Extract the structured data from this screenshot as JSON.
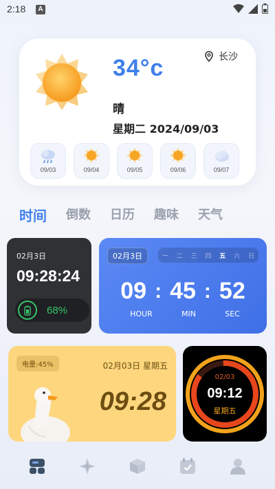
{
  "status_bar": {
    "time": "2:18",
    "indicator": "A"
  },
  "weather": {
    "temperature": "34°c",
    "location": "长沙",
    "condition": "晴",
    "date_line": "星期二 2024/09/03",
    "forecast": [
      {
        "date": "09/03",
        "icon": "rain-cloud-icon"
      },
      {
        "date": "09/04",
        "icon": "sun-icon"
      },
      {
        "date": "09/05",
        "icon": "sun-icon"
      },
      {
        "date": "09/06",
        "icon": "sun-icon"
      },
      {
        "date": "09/07",
        "icon": "cloud-icon"
      }
    ]
  },
  "tabs": [
    {
      "label": "时间",
      "active": true
    },
    {
      "label": "倒数",
      "active": false
    },
    {
      "label": "日历",
      "active": false
    },
    {
      "label": "趣味",
      "active": false
    },
    {
      "label": "天气",
      "active": false
    }
  ],
  "widgets": {
    "dark_clock": {
      "date": "02月3日",
      "time": "09:28:24",
      "battery": "68%"
    },
    "countdown": {
      "date": "02月3日",
      "weekdays": [
        "一",
        "二",
        "三",
        "四",
        "五",
        "六",
        "日"
      ],
      "active_weekday": "五",
      "hour": "09",
      "minute": "45",
      "second": "52",
      "hour_label": "HOUR",
      "minute_label": "MIN",
      "second_label": "SEC"
    },
    "duck_clock": {
      "power": "电量:45%",
      "date": "02月03日 星期五",
      "time": "09:28"
    },
    "ring_clock": {
      "date": "02/03",
      "time": "09:12",
      "weekday": "星期五"
    }
  },
  "bottom_nav": [
    {
      "icon": "widgets-icon",
      "active": true
    },
    {
      "icon": "compass-star-icon",
      "active": false
    },
    {
      "icon": "cube-icon",
      "active": false
    },
    {
      "icon": "calendar-check-icon",
      "active": false
    },
    {
      "icon": "profile-icon",
      "active": false
    }
  ],
  "colors": {
    "accent": "#3f7fea",
    "inactive": "#9aa1ad",
    "battery_green": "#38c46a"
  }
}
